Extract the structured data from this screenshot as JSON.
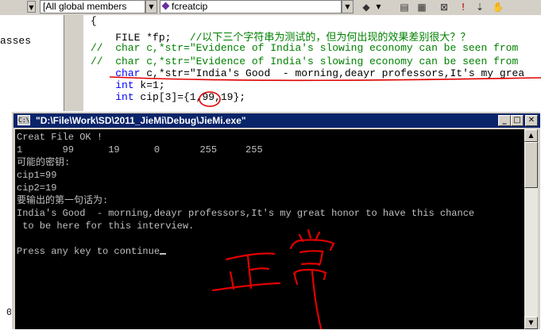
{
  "toolbar": {
    "class_combo": "[All global members",
    "func_combo": "fcreatcip"
  },
  "left_panel": {
    "label": "asses",
    "bottom_glyph": "0"
  },
  "code_lines": [
    {
      "prefix": "",
      "parts": [
        {
          "t": "{",
          "c": ""
        }
      ]
    },
    {
      "prefix": "",
      "parts": [
        {
          "t": "    FILE *fp;   ",
          "c": ""
        },
        {
          "t": "//以下三个字符串为测试的，但为何出现的效果差别很大？？",
          "c": "cm"
        }
      ]
    },
    {
      "prefix": "//",
      "parts": [
        {
          "t": "//  char c,*str=\"Evidence of India's slowing economy can be seen from",
          "c": "cm"
        }
      ]
    },
    {
      "prefix": "//",
      "parts": [
        {
          "t": "//  char c,*str=\"Evidence of India's slowing economy can be seen from",
          "c": "cm"
        }
      ]
    },
    {
      "prefix": "",
      "parts": [
        {
          "t": "    ",
          "c": ""
        },
        {
          "t": "char",
          "c": "kw"
        },
        {
          "t": " c,*str=\"India's Good  - morning,deayr professors,It's my grea",
          "c": ""
        }
      ]
    },
    {
      "prefix": "",
      "parts": [
        {
          "t": "    ",
          "c": ""
        },
        {
          "t": "int",
          "c": "kw"
        },
        {
          "t": " k=1;",
          "c": ""
        }
      ]
    },
    {
      "prefix": "",
      "parts": [
        {
          "t": "    ",
          "c": ""
        },
        {
          "t": "int",
          "c": "kw"
        },
        {
          "t": " cip[3]={1,99,19};",
          "c": ""
        }
      ]
    }
  ],
  "console": {
    "title": "\"D:\\File\\Work\\SD\\2011_JieMi\\Debug\\JieMi.exe\"",
    "icon_text": "C:\\",
    "lines": [
      "Creat File OK !",
      "1       99      19      0       255     255",
      "可能的密钥:",
      "cip1=99",
      "cip2=19",
      "要输出的第一句话为:",
      "India's Good  - morning,deayr professors,It's my great honor to have this chance",
      " to be here for this interview.",
      "",
      "Press any key to continue"
    ]
  },
  "window_buttons": {
    "minimize": "_",
    "maximize": "□",
    "close": "✕"
  },
  "annotation_text": "正常",
  "colors": {
    "title_bar": "#0a246a",
    "ink": "#e00000",
    "keyword": "#0000ff",
    "comment": "#008000"
  }
}
